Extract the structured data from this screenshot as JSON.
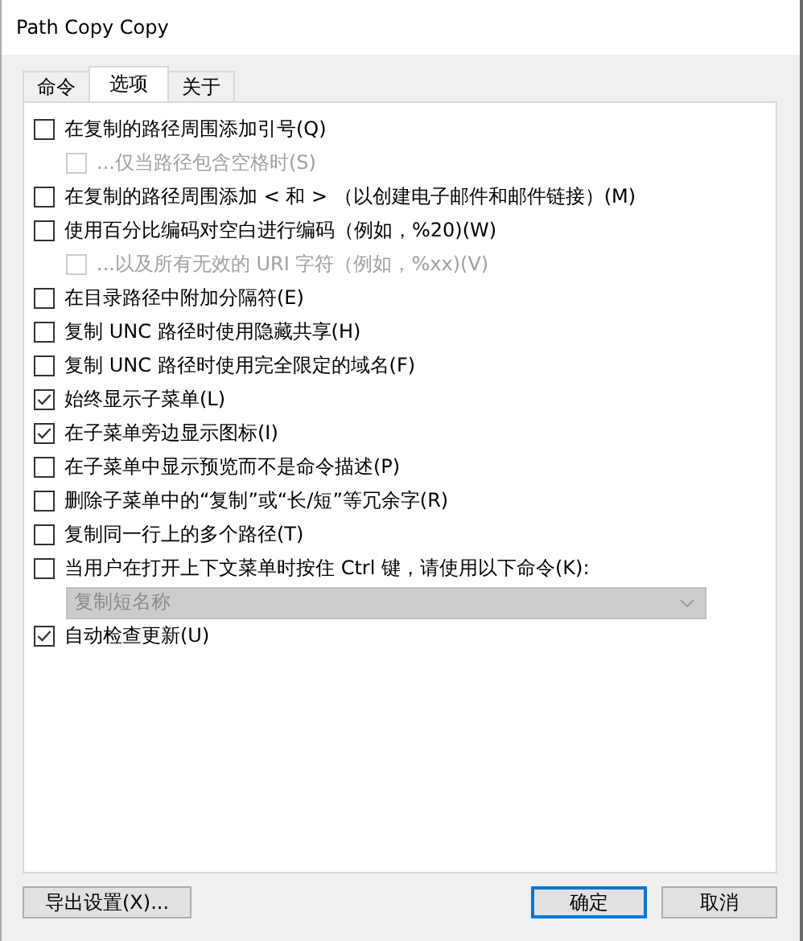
{
  "window": {
    "title": "Path Copy Copy"
  },
  "tabs": [
    {
      "label": "命令",
      "selected": false
    },
    {
      "label": "选项",
      "selected": true
    },
    {
      "label": "关于",
      "selected": false
    }
  ],
  "options": [
    {
      "kind": "checkbox",
      "label": "在复制的路径周围添加引号(Q)",
      "checked": false,
      "disabled": false,
      "children": [
        {
          "kind": "checkbox",
          "label": "...仅当路径包含空格时(S)",
          "checked": false,
          "disabled": true
        }
      ]
    },
    {
      "kind": "checkbox",
      "label": "在复制的路径周围添加 < 和 > （以创建电子邮件和邮件链接）(M)",
      "checked": false,
      "disabled": false
    },
    {
      "kind": "checkbox",
      "label": "使用百分比编码对空白进行编码（例如，%20)(W)",
      "checked": false,
      "disabled": false,
      "children": [
        {
          "kind": "checkbox",
          "label": "...以及所有无效的 URI 字符（例如，%xx)(V)",
          "checked": false,
          "disabled": true
        }
      ]
    },
    {
      "kind": "checkbox",
      "label": "在目录路径中附加分隔符(E)",
      "checked": false,
      "disabled": false
    },
    {
      "kind": "checkbox",
      "label": "复制 UNC 路径时使用隐藏共享(H)",
      "checked": false,
      "disabled": false
    },
    {
      "kind": "checkbox",
      "label": "复制 UNC 路径时使用完全限定的域名(F)",
      "checked": false,
      "disabled": false
    },
    {
      "kind": "checkbox",
      "label": "始终显示子菜单(L)",
      "checked": true,
      "disabled": false
    },
    {
      "kind": "checkbox",
      "label": "在子菜单旁边显示图标(I)",
      "checked": true,
      "disabled": false
    },
    {
      "kind": "checkbox",
      "label": "在子菜单中显示预览而不是命令描述(P)",
      "checked": false,
      "disabled": false
    },
    {
      "kind": "checkbox",
      "label": "删除子菜单中的“复制”或“长/短”等冗余字(R)",
      "checked": false,
      "disabled": false
    },
    {
      "kind": "checkbox",
      "label": "复制同一行上的多个路径(T)",
      "checked": false,
      "disabled": false
    },
    {
      "kind": "checkbox",
      "label": "当用户在打开上下文菜单时按住 Ctrl 键，请使用以下命令(K):",
      "checked": false,
      "disabled": false,
      "children": [
        {
          "kind": "dropdown",
          "value": "复制短名称",
          "disabled": true
        }
      ]
    },
    {
      "kind": "checkbox",
      "label": "自动检查更新(U)",
      "checked": true,
      "disabled": false
    }
  ],
  "buttons": [
    {
      "label": "导出设置(X)...",
      "default": false
    },
    {
      "label": "确定",
      "default": true
    },
    {
      "label": "取消",
      "default": false
    }
  ]
}
